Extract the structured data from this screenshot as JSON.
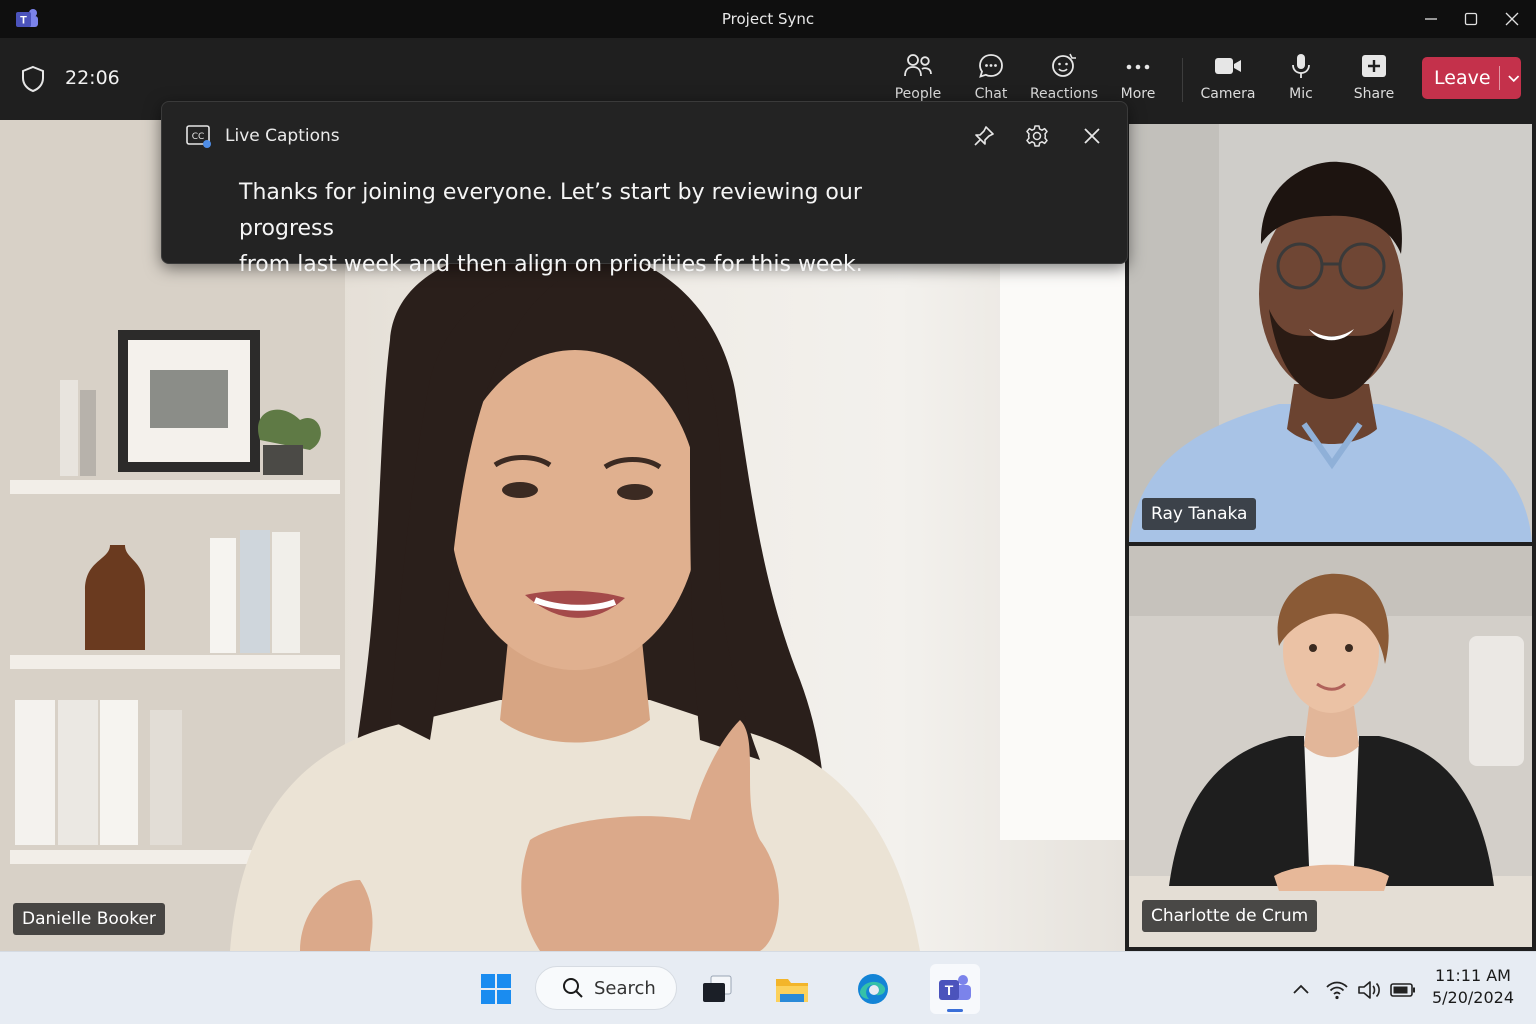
{
  "window": {
    "title": "Project Sync"
  },
  "toolbar": {
    "timer": "22:06",
    "people_label": "People",
    "chat_label": "Chat",
    "reactions_label": "Reactions",
    "more_label": "More",
    "camera_label": "Camera",
    "mic_label": "Mic",
    "share_label": "Share",
    "leave_label": "Leave"
  },
  "captions": {
    "title": "Live Captions",
    "line1": "Thanks for joining everyone. Let’s start by reviewing our progress",
    "line2": "from last week and then align on priorities for this week."
  },
  "participants": [
    {
      "name": "Danielle Booker"
    },
    {
      "name": "Ray Tanaka"
    },
    {
      "name": "Charlotte de Crum"
    }
  ],
  "taskbar": {
    "search_label": "Search",
    "time": "11:11 AM",
    "date": "5/20/2024"
  },
  "colors": {
    "leave": "#c4314b",
    "teams": "#5b5fc7",
    "accent": "#3a6fd8"
  },
  "icons": [
    "teams-icon",
    "shield-icon",
    "people-icon",
    "chat-icon",
    "reactions-icon",
    "more-icon",
    "camera-icon",
    "mic-icon",
    "share-icon",
    "cc-icon",
    "pin-icon",
    "gear-icon",
    "close-icon",
    "windows-start-icon",
    "search-icon",
    "task-view-icon",
    "file-explorer-icon",
    "edge-icon",
    "chevron-up-icon",
    "wifi-icon",
    "volume-icon",
    "battery-icon"
  ]
}
